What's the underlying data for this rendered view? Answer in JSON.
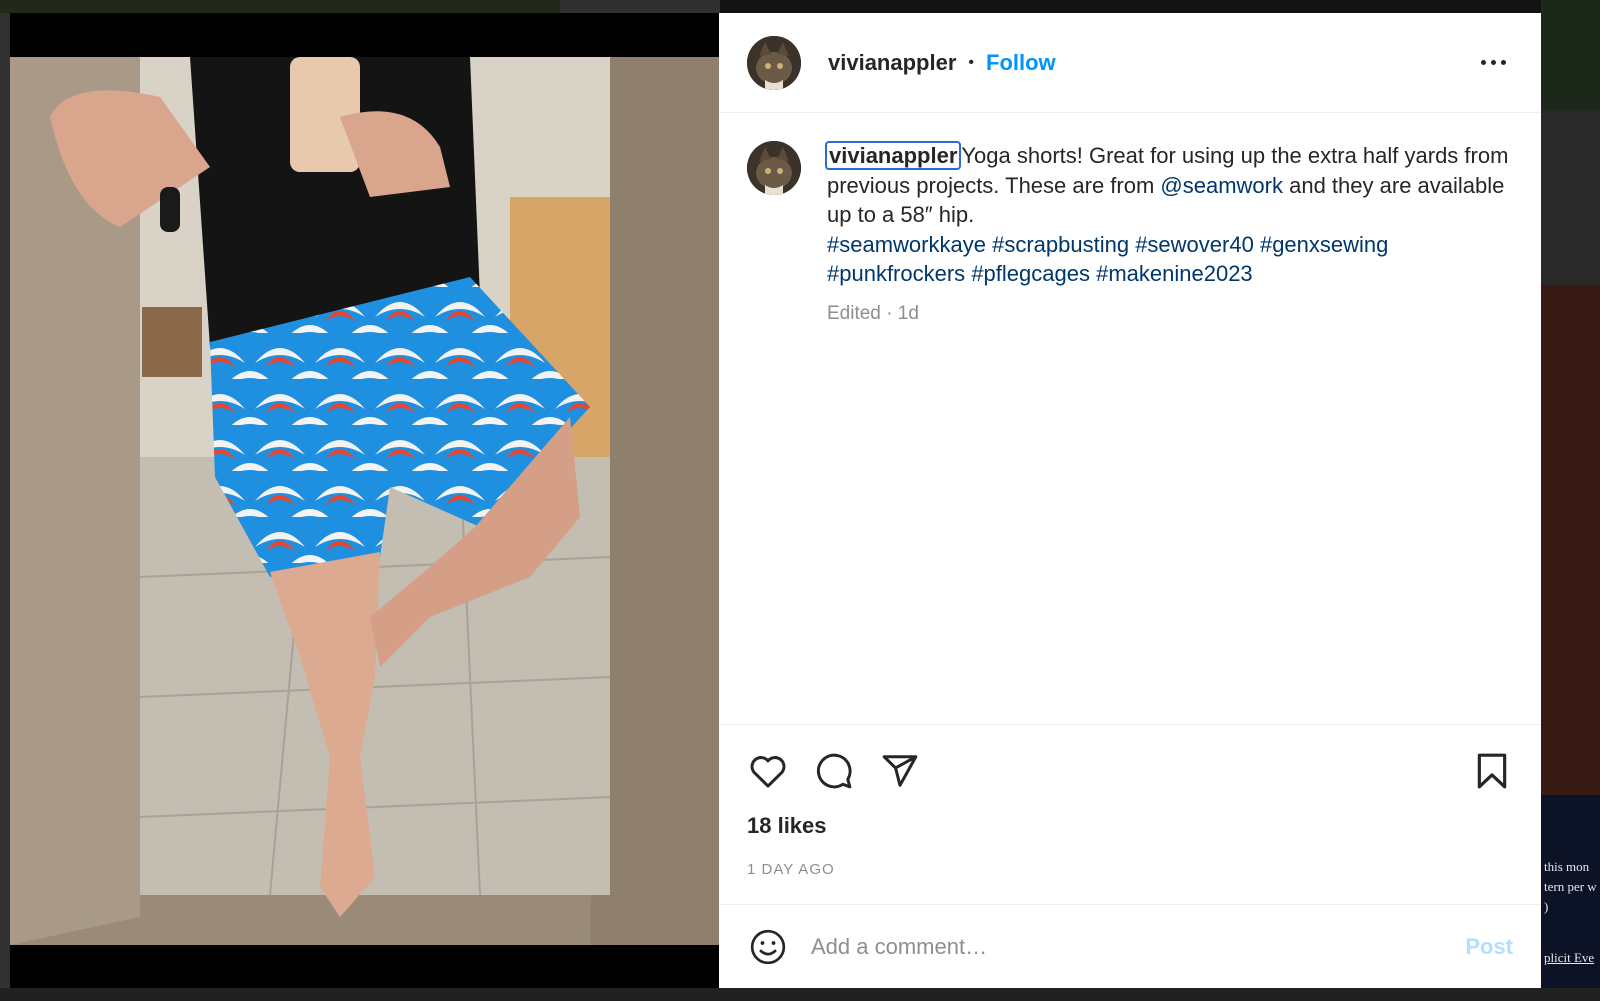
{
  "backdrop": {
    "side_text_1": "this mon",
    "side_text_2": "tern per w",
    "side_text_3": ")",
    "side_text_4": "plicit Eve"
  },
  "post": {
    "username": "vivianappler",
    "separator": "•",
    "follow_label": "Follow",
    "more_icon": "more-horizontal-icon",
    "caption": {
      "username": "vivianappler",
      "text_1": "Yoga shorts! Great for using up the extra half yards from previous projects. These are from ",
      "mention": "@seamwork",
      "text_2": " and they are available up to a 58″ hip.",
      "hashtags": [
        "#seamworkkaye",
        "#scrapbusting",
        "#sewover40",
        "#genxsewing",
        "#punkfrockers",
        "#pflegcages",
        "#makenine2023"
      ]
    },
    "edited_label": "Edited · 1d",
    "likes": "18 likes",
    "timestamp": "1 DAY AGO",
    "comment_placeholder": "Add a comment…",
    "post_label": "Post",
    "icons": {
      "like": "heart-icon",
      "comment": "comment-icon",
      "share": "paper-plane-icon",
      "save": "bookmark-icon",
      "emoji": "smiley-icon"
    },
    "colors": {
      "accent": "#0095f6",
      "link": "#00376b",
      "post_disabled": "#b2dffc"
    }
  }
}
